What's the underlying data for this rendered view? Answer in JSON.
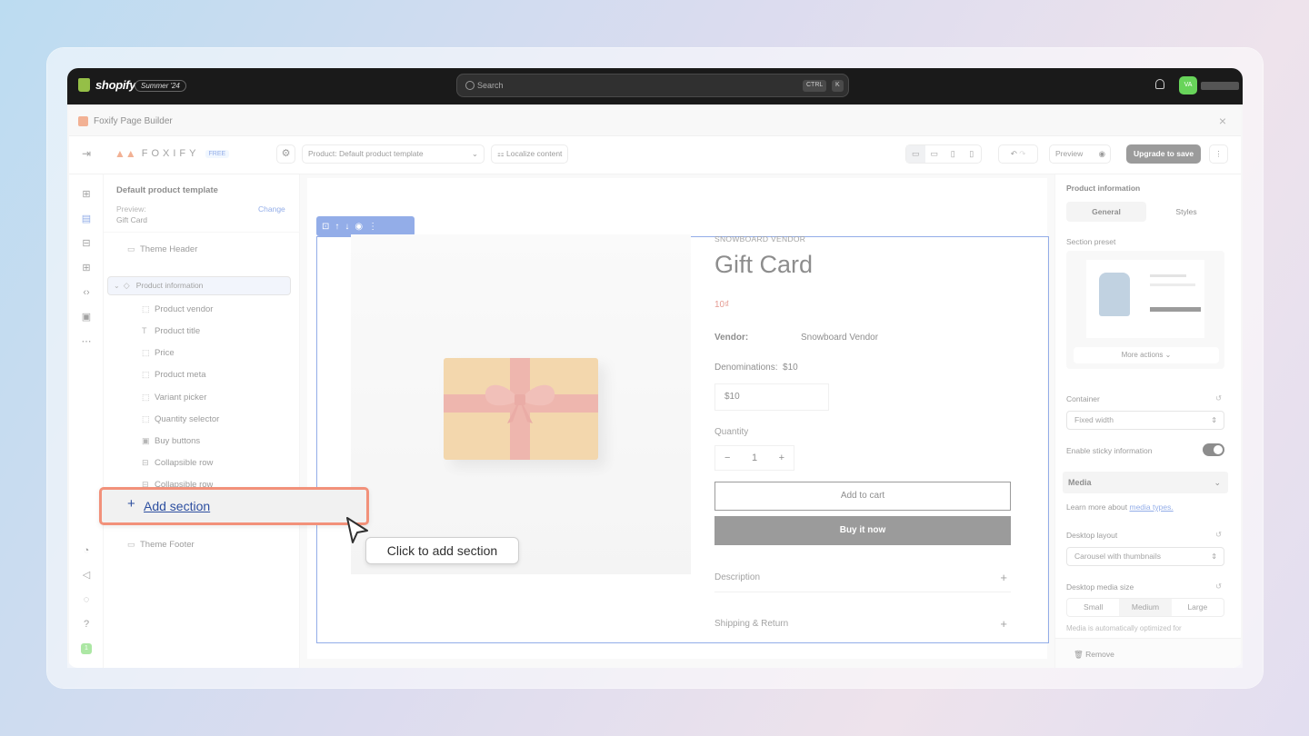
{
  "shopify": {
    "logo_text": "shopify",
    "edition_badge": "Summer '24",
    "search_placeholder": "Search",
    "search_kbd_1": "CTRL",
    "search_kbd_2": "K",
    "avatar_initials": "VA"
  },
  "app": {
    "title": "Foxify Page Builder",
    "close": "×"
  },
  "toolbar": {
    "brand": "FOXIFY",
    "free_badge": "FREE",
    "template_label": "Product: Default product template",
    "localize": "Localize content",
    "preview": "Preview",
    "upgrade": "Upgrade to save"
  },
  "left_panel": {
    "title": "Default product template",
    "preview_label": "Preview:",
    "preview_value": "Gift Card",
    "change": "Change",
    "tree": [
      {
        "label": "Theme Header",
        "icon": "▭"
      },
      {
        "label": "Product information",
        "icon": "◇"
      },
      {
        "label": "Product vendor",
        "icon": "⬚"
      },
      {
        "label": "Product title",
        "icon": "T"
      },
      {
        "label": "Price",
        "icon": "⬚"
      },
      {
        "label": "Product meta",
        "icon": "⬚"
      },
      {
        "label": "Variant picker",
        "icon": "⬚"
      },
      {
        "label": "Quantity selector",
        "icon": "⬚"
      },
      {
        "label": "Buy buttons",
        "icon": "▣"
      },
      {
        "label": "Collapsible row",
        "icon": "⊟"
      },
      {
        "label": "Collapsible row",
        "icon": "⊟"
      },
      {
        "label": "Theme Footer",
        "icon": "▭"
      }
    ]
  },
  "product": {
    "vendor_caption": "SNOWBOARD VENDOR",
    "title": "Gift Card",
    "price": "10₫",
    "vendor_label": "Vendor:",
    "vendor_value": "Snowboard Vendor",
    "denominations_label": "Denominations:",
    "denominations_value": "$10",
    "denomination_option": "$10",
    "quantity_label": "Quantity",
    "qty_minus": "−",
    "quantity_value": "1",
    "qty_plus": "+",
    "add_to_cart": "Add to cart",
    "buy_now": "Buy it now",
    "accordions": [
      "Description",
      "Shipping & Return"
    ],
    "accordion_plus": "+"
  },
  "right_panel": {
    "title": "Product information",
    "tabs": [
      "General",
      "Styles"
    ],
    "section_preset": "Section preset",
    "more_actions": "More actions ⌄",
    "container_label": "Container",
    "container_value": "Fixed width",
    "sticky_label": "Enable sticky information",
    "sticky_on": true,
    "media_header": "Media",
    "learn_more_prefix": "Learn more about",
    "learn_more_link": "media types.",
    "desktop_layout_label": "Desktop layout",
    "desktop_layout_value": "Carousel with thumbnails",
    "media_size_label": "Desktop media size",
    "media_sizes": [
      "Small",
      "Medium",
      "Large"
    ],
    "media_note": "Media is automatically optimized for",
    "remove": "Remove"
  },
  "callout": {
    "add_section": "Add section",
    "tooltip": "Click to add section"
  },
  "colors": {
    "accent": "#3b6bd6",
    "highlight": "#f2917a",
    "primary_button": "#4a4a4a"
  }
}
